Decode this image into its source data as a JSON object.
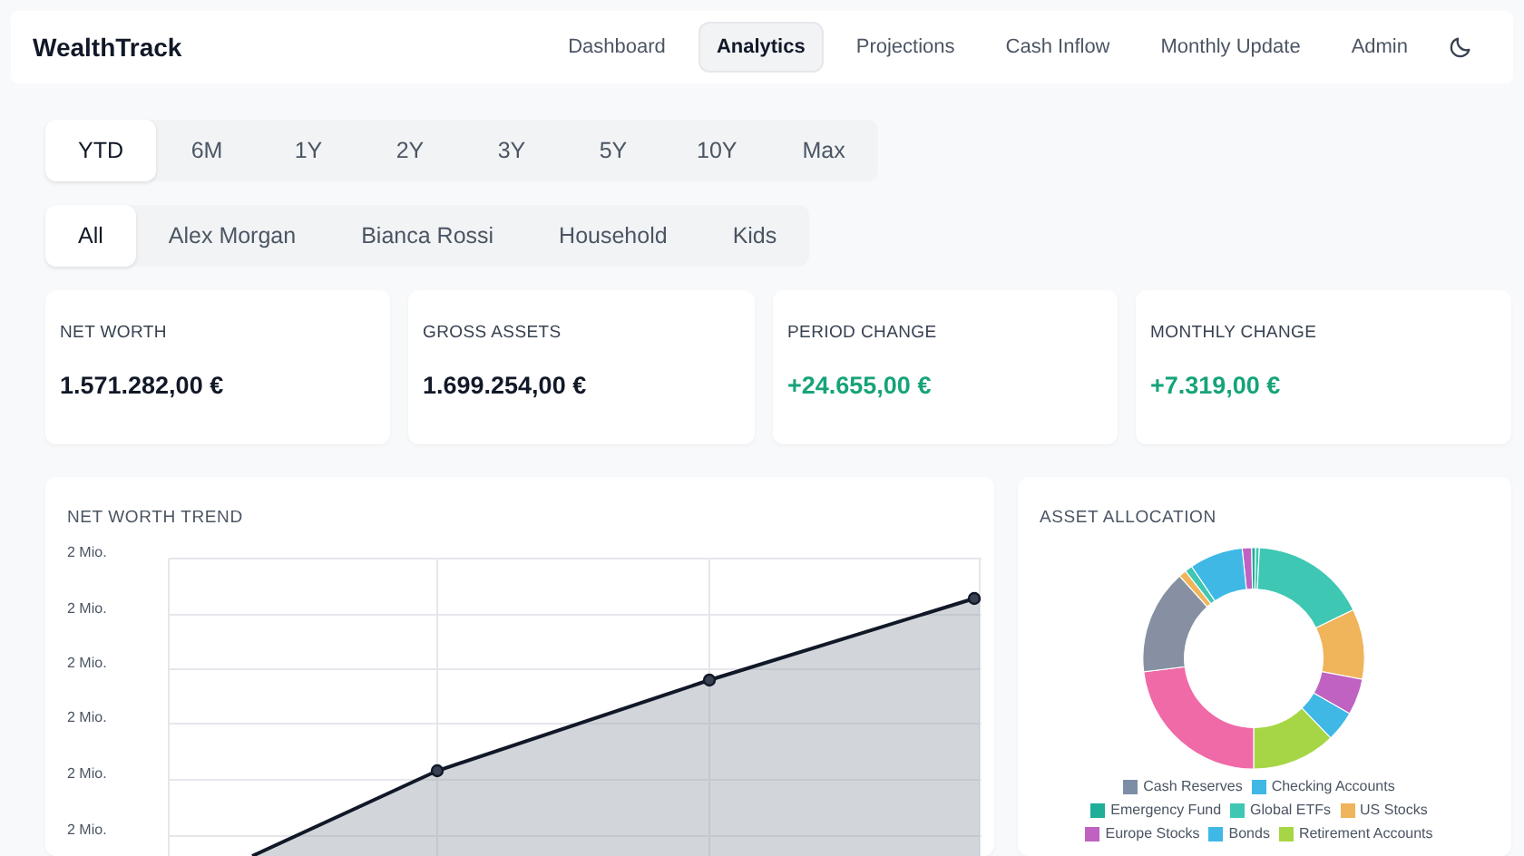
{
  "brand": "WealthTrack",
  "nav": [
    {
      "label": "Dashboard",
      "selected": false
    },
    {
      "label": "Analytics",
      "selected": true
    },
    {
      "label": "Projections",
      "selected": false
    },
    {
      "label": "Cash Inflow",
      "selected": false
    },
    {
      "label": "Monthly Update",
      "selected": false
    },
    {
      "label": "Admin",
      "selected": false
    }
  ],
  "ranges": [
    {
      "label": "YTD",
      "selected": true
    },
    {
      "label": "6M",
      "selected": false
    },
    {
      "label": "1Y",
      "selected": false
    },
    {
      "label": "2Y",
      "selected": false
    },
    {
      "label": "3Y",
      "selected": false
    },
    {
      "label": "5Y",
      "selected": false
    },
    {
      "label": "10Y",
      "selected": false
    },
    {
      "label": "Max",
      "selected": false
    }
  ],
  "people": [
    {
      "label": "All",
      "selected": true
    },
    {
      "label": "Alex Morgan",
      "selected": false
    },
    {
      "label": "Bianca Rossi",
      "selected": false
    },
    {
      "label": "Household",
      "selected": false
    },
    {
      "label": "Kids",
      "selected": false
    }
  ],
  "stats": [
    {
      "label": "NET WORTH",
      "value": "1.571.282,00 €",
      "positive": false
    },
    {
      "label": "GROSS ASSETS",
      "value": "1.699.254,00 €",
      "positive": false
    },
    {
      "label": "PERIOD CHANGE",
      "value": "+24.655,00 €",
      "positive": true
    },
    {
      "label": "MONTHLY CHANGE",
      "value": "+7.319,00 €",
      "positive": true
    }
  ],
  "trend": {
    "title": "NET WORTH TREND",
    "y_labels": [
      "2 Mio.",
      "2 Mio.",
      "2 Mio.",
      "2 Mio.",
      "2 Mio.",
      "2 Mio."
    ]
  },
  "allocation": {
    "title": "ASSET ALLOCATION",
    "legend": [
      [
        {
          "label": "Cash Reserves",
          "color": "#7b8ea6"
        },
        {
          "label": "Checking Accounts",
          "color": "#3fb8e6"
        }
      ],
      [
        {
          "label": "Emergency Fund",
          "color": "#1fae98"
        },
        {
          "label": "Global ETFs",
          "color": "#3ec7b3"
        },
        {
          "label": "US Stocks",
          "color": "#f0b45a"
        }
      ],
      [
        {
          "label": "Europe Stocks",
          "color": "#bf62c2"
        },
        {
          "label": "Bonds",
          "color": "#3fb8e6"
        },
        {
          "label": "Retirement Accounts",
          "color": "#a6d645"
        }
      ]
    ]
  }
}
